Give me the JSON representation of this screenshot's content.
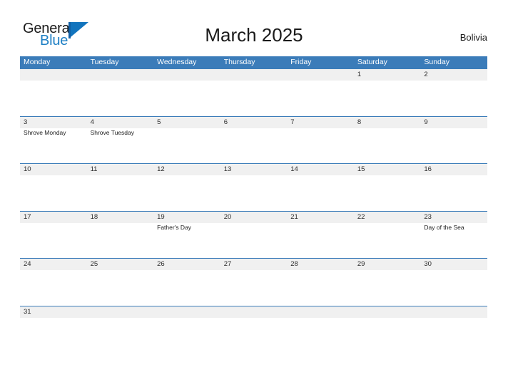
{
  "brand": {
    "word_one": "General",
    "word_two": "Blue",
    "flag_icon": "general-blue-flag-icon",
    "accent_color": "#1e7fc4",
    "dark_color": "#1a1a1a"
  },
  "header": {
    "title": "March 2025",
    "country": "Bolivia"
  },
  "calendar": {
    "header_bg": "#3b7cb9",
    "band_bg": "#f0f0f0",
    "grid_line": "#3b7cb9",
    "weekdays": [
      "Monday",
      "Tuesday",
      "Wednesday",
      "Thursday",
      "Friday",
      "Saturday",
      "Sunday"
    ],
    "weeks": [
      {
        "days": [
          {
            "num": "",
            "event": ""
          },
          {
            "num": "",
            "event": ""
          },
          {
            "num": "",
            "event": ""
          },
          {
            "num": "",
            "event": ""
          },
          {
            "num": "",
            "event": ""
          },
          {
            "num": "1",
            "event": ""
          },
          {
            "num": "2",
            "event": ""
          }
        ]
      },
      {
        "days": [
          {
            "num": "3",
            "event": "Shrove Monday"
          },
          {
            "num": "4",
            "event": "Shrove Tuesday"
          },
          {
            "num": "5",
            "event": ""
          },
          {
            "num": "6",
            "event": ""
          },
          {
            "num": "7",
            "event": ""
          },
          {
            "num": "8",
            "event": ""
          },
          {
            "num": "9",
            "event": ""
          }
        ]
      },
      {
        "days": [
          {
            "num": "10",
            "event": ""
          },
          {
            "num": "11",
            "event": ""
          },
          {
            "num": "12",
            "event": ""
          },
          {
            "num": "13",
            "event": ""
          },
          {
            "num": "14",
            "event": ""
          },
          {
            "num": "15",
            "event": ""
          },
          {
            "num": "16",
            "event": ""
          }
        ]
      },
      {
        "days": [
          {
            "num": "17",
            "event": ""
          },
          {
            "num": "18",
            "event": ""
          },
          {
            "num": "19",
            "event": "Father's Day"
          },
          {
            "num": "20",
            "event": ""
          },
          {
            "num": "21",
            "event": ""
          },
          {
            "num": "22",
            "event": ""
          },
          {
            "num": "23",
            "event": "Day of the Sea"
          }
        ]
      },
      {
        "days": [
          {
            "num": "24",
            "event": ""
          },
          {
            "num": "25",
            "event": ""
          },
          {
            "num": "26",
            "event": ""
          },
          {
            "num": "27",
            "event": ""
          },
          {
            "num": "28",
            "event": ""
          },
          {
            "num": "29",
            "event": ""
          },
          {
            "num": "30",
            "event": ""
          }
        ]
      },
      {
        "last": true,
        "days": [
          {
            "num": "31",
            "event": ""
          },
          {
            "num": "",
            "event": ""
          },
          {
            "num": "",
            "event": ""
          },
          {
            "num": "",
            "event": ""
          },
          {
            "num": "",
            "event": ""
          },
          {
            "num": "",
            "event": ""
          },
          {
            "num": "",
            "event": ""
          }
        ]
      }
    ]
  }
}
